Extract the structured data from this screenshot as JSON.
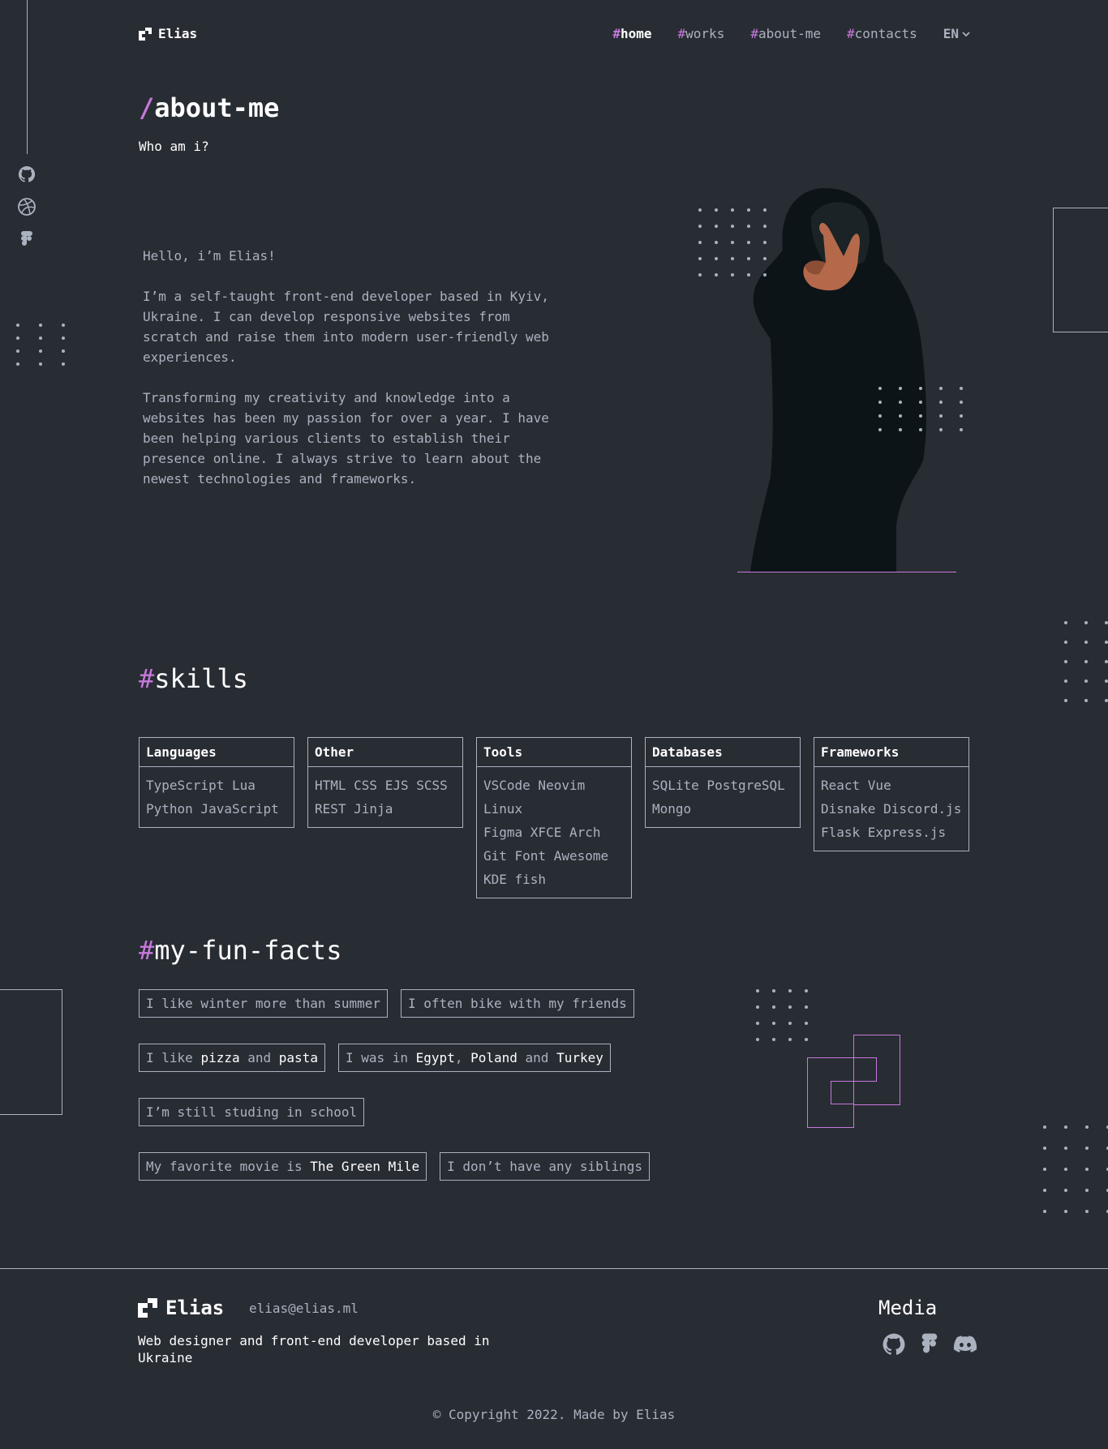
{
  "header": {
    "logo_text": "Elias",
    "nav": [
      {
        "hash": "#",
        "label": "home"
      },
      {
        "hash": "#",
        "label": "works"
      },
      {
        "hash": "#",
        "label": "about-me"
      },
      {
        "hash": "#",
        "label": "contacts"
      }
    ],
    "lang": "EN"
  },
  "page": {
    "title_slash": "/",
    "title": "about-me",
    "subtitle": "Who am i?"
  },
  "about": {
    "paragraphs": [
      "Hello, i’m Elias!",
      "I’m a self-taught front-end developer based in Kyiv, Ukraine. I can develop responsive websites from scratch and raise them into modern user-friendly web experiences.",
      "Transforming my creativity and knowledge into a websites has been my passion for over a year. I have been helping various clients to establish their presence online. I always strive to learn about the newest technologies and frameworks."
    ]
  },
  "skills": {
    "hash": "#",
    "title": "skills",
    "groups": [
      {
        "name": "Languages",
        "lines": [
          "TypeScript Lua",
          "Python JavaScript"
        ]
      },
      {
        "name": "Other",
        "lines": [
          "HTML CSS EJS SCSS",
          "REST Jinja"
        ]
      },
      {
        "name": "Tools",
        "lines": [
          "VSCode Neovim Linux",
          "Figma XFCE Arch",
          "Git Font Awesome",
          "KDE fish"
        ]
      },
      {
        "name": "Databases",
        "lines": [
          "SQLite PostgreSQL",
          "Mongo"
        ]
      },
      {
        "name": "Frameworks",
        "lines": [
          "React Vue",
          "Disnake Discord.js",
          "Flask Express.js"
        ]
      }
    ]
  },
  "fun_facts": {
    "hash": "#",
    "title": "my-fun-facts",
    "items": {
      "f1": "I like winter more than summer",
      "f2": "I often bike with my friends",
      "f3a": "I like ",
      "f3b": "pizza",
      "f3c": " and ",
      "f3d": "pasta",
      "f4a": "I was in ",
      "f4b": "Egypt",
      "f4c": ", ",
      "f4d": "Poland",
      "f4e": " and ",
      "f4f": "Turkey",
      "f5": "I’m still studing in school",
      "f6a": "My favorite movie is ",
      "f6b": "The Green Mile",
      "f7": "I don’t have any siblings"
    }
  },
  "footer": {
    "logo_text": "Elias",
    "email": "elias@elias.ml",
    "description": "Web designer and front-end developer based in Ukraine",
    "media_title": "Media",
    "copyright": "© Copyright 2022. Made by Elias"
  },
  "colors": {
    "background": "#282C33",
    "accent": "#C778DD",
    "text": "#ABB2BF",
    "heading": "#FFFFFF"
  },
  "icons": [
    "logo-icon",
    "github-icon",
    "dribbble-icon",
    "figma-icon",
    "discord-icon",
    "chevron-down-icon"
  ]
}
